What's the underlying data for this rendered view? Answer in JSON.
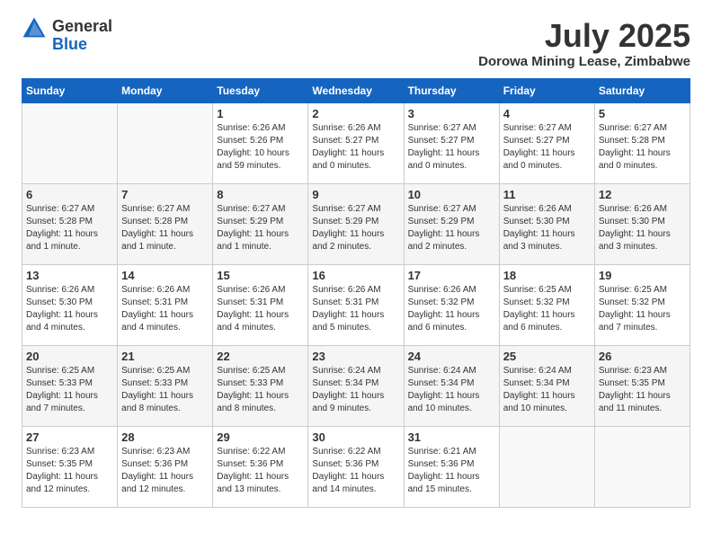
{
  "header": {
    "logo_general": "General",
    "logo_blue": "Blue",
    "month_title": "July 2025",
    "location": "Dorowa Mining Lease, Zimbabwe"
  },
  "days_of_week": [
    "Sunday",
    "Monday",
    "Tuesday",
    "Wednesday",
    "Thursday",
    "Friday",
    "Saturday"
  ],
  "weeks": [
    [
      {
        "day": "",
        "text": ""
      },
      {
        "day": "",
        "text": ""
      },
      {
        "day": "1",
        "text": "Sunrise: 6:26 AM\nSunset: 5:26 PM\nDaylight: 10 hours and 59 minutes."
      },
      {
        "day": "2",
        "text": "Sunrise: 6:26 AM\nSunset: 5:27 PM\nDaylight: 11 hours and 0 minutes."
      },
      {
        "day": "3",
        "text": "Sunrise: 6:27 AM\nSunset: 5:27 PM\nDaylight: 11 hours and 0 minutes."
      },
      {
        "day": "4",
        "text": "Sunrise: 6:27 AM\nSunset: 5:27 PM\nDaylight: 11 hours and 0 minutes."
      },
      {
        "day": "5",
        "text": "Sunrise: 6:27 AM\nSunset: 5:28 PM\nDaylight: 11 hours and 0 minutes."
      }
    ],
    [
      {
        "day": "6",
        "text": "Sunrise: 6:27 AM\nSunset: 5:28 PM\nDaylight: 11 hours and 1 minute."
      },
      {
        "day": "7",
        "text": "Sunrise: 6:27 AM\nSunset: 5:28 PM\nDaylight: 11 hours and 1 minute."
      },
      {
        "day": "8",
        "text": "Sunrise: 6:27 AM\nSunset: 5:29 PM\nDaylight: 11 hours and 1 minute."
      },
      {
        "day": "9",
        "text": "Sunrise: 6:27 AM\nSunset: 5:29 PM\nDaylight: 11 hours and 2 minutes."
      },
      {
        "day": "10",
        "text": "Sunrise: 6:27 AM\nSunset: 5:29 PM\nDaylight: 11 hours and 2 minutes."
      },
      {
        "day": "11",
        "text": "Sunrise: 6:26 AM\nSunset: 5:30 PM\nDaylight: 11 hours and 3 minutes."
      },
      {
        "day": "12",
        "text": "Sunrise: 6:26 AM\nSunset: 5:30 PM\nDaylight: 11 hours and 3 minutes."
      }
    ],
    [
      {
        "day": "13",
        "text": "Sunrise: 6:26 AM\nSunset: 5:30 PM\nDaylight: 11 hours and 4 minutes."
      },
      {
        "day": "14",
        "text": "Sunrise: 6:26 AM\nSunset: 5:31 PM\nDaylight: 11 hours and 4 minutes."
      },
      {
        "day": "15",
        "text": "Sunrise: 6:26 AM\nSunset: 5:31 PM\nDaylight: 11 hours and 4 minutes."
      },
      {
        "day": "16",
        "text": "Sunrise: 6:26 AM\nSunset: 5:31 PM\nDaylight: 11 hours and 5 minutes."
      },
      {
        "day": "17",
        "text": "Sunrise: 6:26 AM\nSunset: 5:32 PM\nDaylight: 11 hours and 6 minutes."
      },
      {
        "day": "18",
        "text": "Sunrise: 6:25 AM\nSunset: 5:32 PM\nDaylight: 11 hours and 6 minutes."
      },
      {
        "day": "19",
        "text": "Sunrise: 6:25 AM\nSunset: 5:32 PM\nDaylight: 11 hours and 7 minutes."
      }
    ],
    [
      {
        "day": "20",
        "text": "Sunrise: 6:25 AM\nSunset: 5:33 PM\nDaylight: 11 hours and 7 minutes."
      },
      {
        "day": "21",
        "text": "Sunrise: 6:25 AM\nSunset: 5:33 PM\nDaylight: 11 hours and 8 minutes."
      },
      {
        "day": "22",
        "text": "Sunrise: 6:25 AM\nSunset: 5:33 PM\nDaylight: 11 hours and 8 minutes."
      },
      {
        "day": "23",
        "text": "Sunrise: 6:24 AM\nSunset: 5:34 PM\nDaylight: 11 hours and 9 minutes."
      },
      {
        "day": "24",
        "text": "Sunrise: 6:24 AM\nSunset: 5:34 PM\nDaylight: 11 hours and 10 minutes."
      },
      {
        "day": "25",
        "text": "Sunrise: 6:24 AM\nSunset: 5:34 PM\nDaylight: 11 hours and 10 minutes."
      },
      {
        "day": "26",
        "text": "Sunrise: 6:23 AM\nSunset: 5:35 PM\nDaylight: 11 hours and 11 minutes."
      }
    ],
    [
      {
        "day": "27",
        "text": "Sunrise: 6:23 AM\nSunset: 5:35 PM\nDaylight: 11 hours and 12 minutes."
      },
      {
        "day": "28",
        "text": "Sunrise: 6:23 AM\nSunset: 5:36 PM\nDaylight: 11 hours and 12 minutes."
      },
      {
        "day": "29",
        "text": "Sunrise: 6:22 AM\nSunset: 5:36 PM\nDaylight: 11 hours and 13 minutes."
      },
      {
        "day": "30",
        "text": "Sunrise: 6:22 AM\nSunset: 5:36 PM\nDaylight: 11 hours and 14 minutes."
      },
      {
        "day": "31",
        "text": "Sunrise: 6:21 AM\nSunset: 5:36 PM\nDaylight: 11 hours and 15 minutes."
      },
      {
        "day": "",
        "text": ""
      },
      {
        "day": "",
        "text": ""
      }
    ]
  ]
}
